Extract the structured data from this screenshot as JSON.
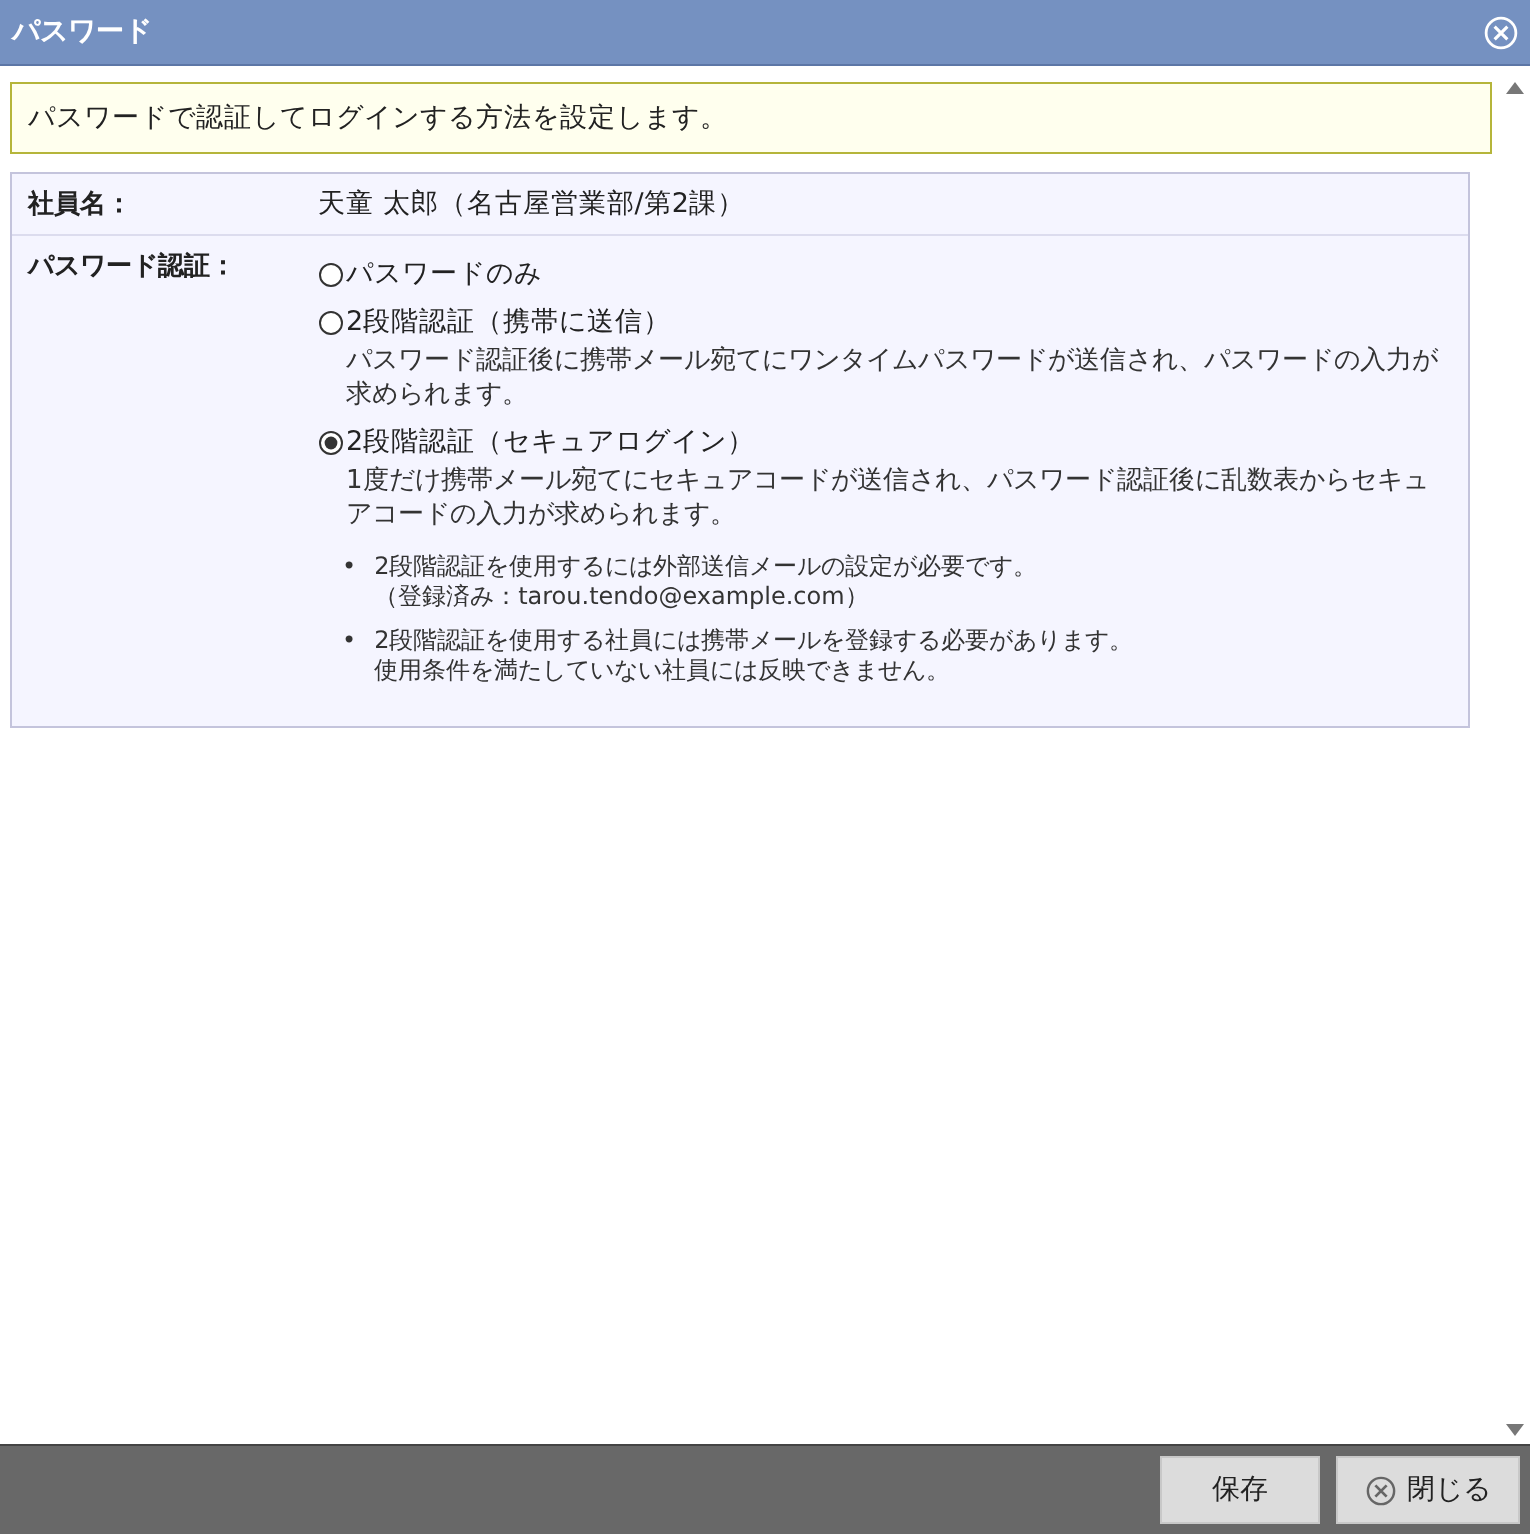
{
  "window": {
    "title": "パスワード"
  },
  "notice": "パスワードで認証してログインする方法を設定します。",
  "form": {
    "rows": [
      {
        "label": "社員名：",
        "kind": "text",
        "value": "天童 太郎（名古屋営業部/第2課）"
      },
      {
        "label": "パスワード認証：",
        "kind": "radios",
        "options": [
          {
            "label": "パスワードのみ",
            "selected": false
          },
          {
            "label": "2段階認証（携帯に送信）",
            "selected": false,
            "description": [
              "パスワード認証後に携帯メール宛てにワンタイムパスワードが送信され、パスワードの入力が",
              "求められます。"
            ]
          },
          {
            "label": "2段階認証（セキュアログイン）",
            "selected": true,
            "description": [
              "1度だけ携帯メール宛てにセキュアコードが送信され、パスワード認証後に乱数表からセキュ",
              "アコードの入力が求められます。"
            ]
          }
        ],
        "notes": [
          {
            "bullet": "•",
            "lines": [
              "2段階認証を使用するには外部送信メールの設定が必要です。",
              "（登録済み：tarou.tendo@example.com）"
            ]
          },
          {
            "bullet": "•",
            "lines": [
              "2段階認証を使用する社員には携帯メールを登録する必要があります。",
              "使用条件を満たしていない社員には反映できません。"
            ]
          }
        ]
      }
    ]
  },
  "buttons": [
    {
      "label": "保存",
      "kind": "plain"
    },
    {
      "label": "閉じる",
      "kind": "close"
    }
  ]
}
